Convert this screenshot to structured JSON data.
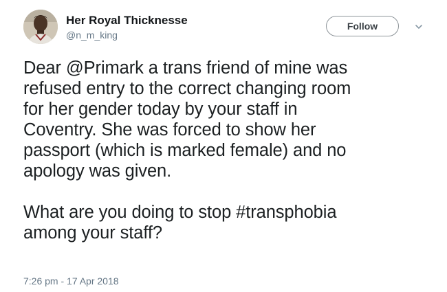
{
  "tweet": {
    "author": {
      "display_name": "Her Royal Thicknesse",
      "handle": "@n_m_king"
    },
    "follow_label": "Follow",
    "menu_icon": "chevron-down-icon",
    "body": {
      "line1_pre": "Dear ",
      "line1_mention": "@Primark",
      "line1_post": " a trans friend of mine was",
      "line2": "refused entry to the correct changing room",
      "line3": "for her gender today by your staff in",
      "line4": "Coventry. She was forced to show her",
      "line5": "passport (which is marked female) and no",
      "line6": "apology was given.",
      "line7_pre": "What are you doing to stop ",
      "line7_hashtag": "#transphobia",
      "line8": "among your staff?"
    },
    "timestamp": "7:26 pm - 17 Apr 2018"
  },
  "colors": {
    "text": "#1c2022",
    "secondary": "#657786",
    "follow_border": "#8c9398"
  }
}
